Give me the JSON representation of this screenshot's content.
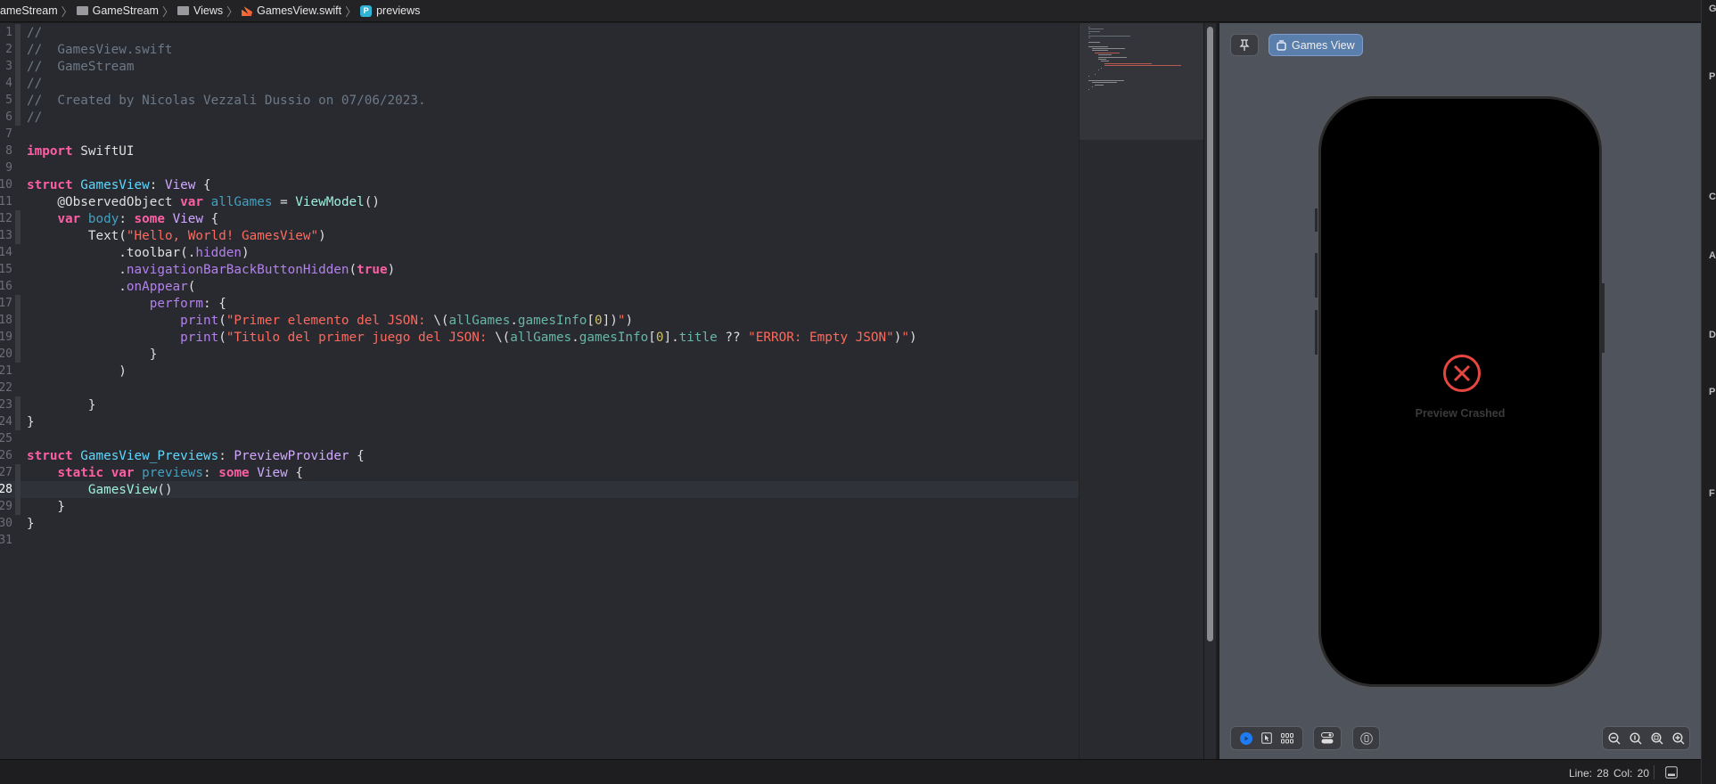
{
  "breadcrumb": [
    "ameStream",
    "GameStream",
    "Views",
    "GamesView.swift",
    "previews"
  ],
  "editor": {
    "current_line": 28,
    "lines": [
      [
        [
          "c",
          "//"
        ]
      ],
      [
        [
          "c",
          "//  GamesView.swift"
        ]
      ],
      [
        [
          "c",
          "//  GameStream"
        ]
      ],
      [
        [
          "c",
          "//"
        ]
      ],
      [
        [
          "c",
          "//  Created by Nicolas Vezzali Dussio on 07/06/2023."
        ]
      ],
      [
        [
          "c",
          "//"
        ]
      ],
      [],
      [
        [
          "k",
          "import"
        ],
        [
          "x",
          " SwiftUI"
        ]
      ],
      [],
      [
        [
          "k",
          "struct"
        ],
        [
          "x",
          " "
        ],
        [
          "p",
          "GamesView"
        ],
        [
          "x",
          ": "
        ],
        [
          "t",
          "View"
        ],
        [
          "x",
          " {"
        ]
      ],
      [
        [
          "x",
          "    @ObservedObject "
        ],
        [
          "k",
          "var"
        ],
        [
          "x",
          " "
        ],
        [
          "v",
          "allGames"
        ],
        [
          "x",
          " = "
        ],
        [
          "m",
          "ViewModel"
        ],
        [
          "x",
          "()"
        ]
      ],
      [
        [
          "x",
          "    "
        ],
        [
          "k",
          "var"
        ],
        [
          "x",
          " "
        ],
        [
          "v",
          "body"
        ],
        [
          "x",
          ": "
        ],
        [
          "k",
          "some"
        ],
        [
          "x",
          " "
        ],
        [
          "t",
          "View"
        ],
        [
          "x",
          " {"
        ]
      ],
      [
        [
          "x",
          "        Text("
        ],
        [
          "s",
          "\"Hello, World! GamesView\""
        ],
        [
          "x",
          ")"
        ]
      ],
      [
        [
          "x",
          "            .toolbar(."
        ],
        [
          "f",
          "hidden"
        ],
        [
          "x",
          ")"
        ]
      ],
      [
        [
          "x",
          "            ."
        ],
        [
          "f",
          "navigationBarBackButtonHidden"
        ],
        [
          "x",
          "("
        ],
        [
          "k",
          "true"
        ],
        [
          "x",
          ")"
        ]
      ],
      [
        [
          "x",
          "            ."
        ],
        [
          "f",
          "onAppear"
        ],
        [
          "x",
          "("
        ]
      ],
      [
        [
          "x",
          "                "
        ],
        [
          "f",
          "perform"
        ],
        [
          "x",
          ": {"
        ]
      ],
      [
        [
          "x",
          "                    "
        ],
        [
          "f",
          "print"
        ],
        [
          "x",
          "("
        ],
        [
          "s",
          "\"Primer elemento del JSON: "
        ],
        [
          "x",
          "\\("
        ],
        [
          "w",
          "allGames"
        ],
        [
          "x",
          "."
        ],
        [
          "w",
          "gamesInfo"
        ],
        [
          "x",
          "["
        ],
        [
          "n",
          "0"
        ],
        [
          "x",
          "])"
        ],
        [
          "s",
          "\""
        ],
        [
          "x",
          ")"
        ]
      ],
      [
        [
          "x",
          "                    "
        ],
        [
          "f",
          "print"
        ],
        [
          "x",
          "("
        ],
        [
          "s",
          "\"Titulo del primer juego del JSON: "
        ],
        [
          "x",
          "\\("
        ],
        [
          "w",
          "allGames"
        ],
        [
          "x",
          "."
        ],
        [
          "w",
          "gamesInfo"
        ],
        [
          "x",
          "["
        ],
        [
          "n",
          "0"
        ],
        [
          "x",
          "]."
        ],
        [
          "w",
          "title"
        ],
        [
          "x",
          " ?? "
        ],
        [
          "s",
          "\"ERROR: Empty JSON\""
        ],
        [
          "x",
          ")"
        ],
        [
          "s",
          "\""
        ],
        [
          "x",
          ")"
        ]
      ],
      [
        [
          "x",
          "                }"
        ]
      ],
      [
        [
          "x",
          "            )"
        ]
      ],
      [],
      [
        [
          "x",
          "        }"
        ]
      ],
      [
        [
          "x",
          "}"
        ]
      ],
      [],
      [
        [
          "k",
          "struct"
        ],
        [
          "x",
          " "
        ],
        [
          "p",
          "GamesView_Previews"
        ],
        [
          "x",
          ": "
        ],
        [
          "t",
          "PreviewProvider"
        ],
        [
          "x",
          " {"
        ]
      ],
      [
        [
          "x",
          "    "
        ],
        [
          "k",
          "static"
        ],
        [
          "x",
          " "
        ],
        [
          "k",
          "var"
        ],
        [
          "x",
          " "
        ],
        [
          "v",
          "previews"
        ],
        [
          "x",
          ": "
        ],
        [
          "k",
          "some"
        ],
        [
          "x",
          " "
        ],
        [
          "t",
          "View"
        ],
        [
          "x",
          " {"
        ]
      ],
      [
        [
          "x",
          "        "
        ],
        [
          "m",
          "GamesView"
        ],
        [
          "x",
          "()"
        ]
      ],
      [
        [
          "x",
          "    }"
        ]
      ],
      [
        [
          "x",
          "}"
        ]
      ],
      []
    ]
  },
  "preview": {
    "pin_icon": "pin-icon",
    "view_button": "Games View",
    "crash_text": "Preview Crashed",
    "crash_color": "#e5463f"
  },
  "status": {
    "line_col": "Line: 28  Col: 20"
  },
  "inspector_letters": [
    "G",
    "P",
    "C",
    "A",
    "D",
    "P",
    "F"
  ]
}
